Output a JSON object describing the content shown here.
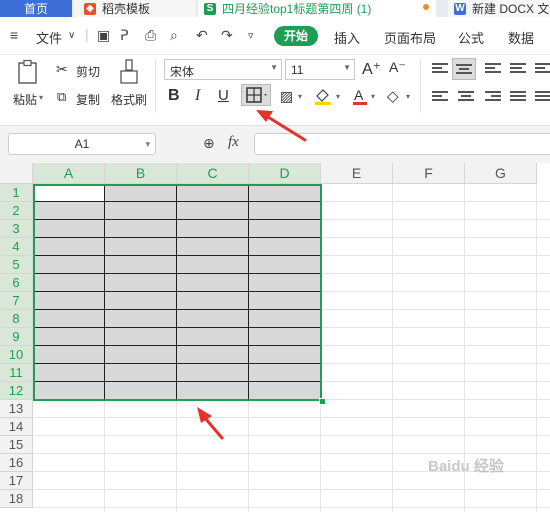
{
  "tabs": [
    {
      "label": "首页",
      "active": true
    },
    {
      "label": "稻壳模板",
      "icon": "docer-icon"
    },
    {
      "label": "四月经验top1标题第四周 (1)",
      "icon": "sheet-icon"
    },
    {
      "label": "新建 DOCX 文",
      "icon": "word-icon"
    }
  ],
  "menu": {
    "file_label": "文件",
    "items": [
      "开始",
      "插入",
      "页面布局",
      "公式",
      "数据"
    ]
  },
  "ribbon": {
    "cut": "剪切",
    "paste": "粘贴",
    "copy": "复制",
    "format_painter": "格式刷",
    "font_name": "宋体",
    "font_size": "11",
    "grow_font": "A⁺",
    "shrink_font": "A⁻",
    "bold": "B",
    "italic": "I",
    "underline": "U"
  },
  "formula_bar": {
    "cell_ref": "A1",
    "fx": "fx"
  },
  "sheet": {
    "columns": [
      "A",
      "B",
      "C",
      "D",
      "E",
      "F",
      "G"
    ],
    "rows": [
      "1",
      "2",
      "3",
      "4",
      "5",
      "6",
      "7",
      "8",
      "9",
      "10",
      "11",
      "12",
      "13",
      "14",
      "15",
      "16",
      "17",
      "18"
    ],
    "selected_range": "A1:D12",
    "fill_color": "#d9d9d9"
  },
  "colors": {
    "accent_green": "#1f9d52",
    "home_tab_blue": "#3d6fd6",
    "annotation_red": "#e8312b"
  },
  "watermark": "Baidu 经验"
}
